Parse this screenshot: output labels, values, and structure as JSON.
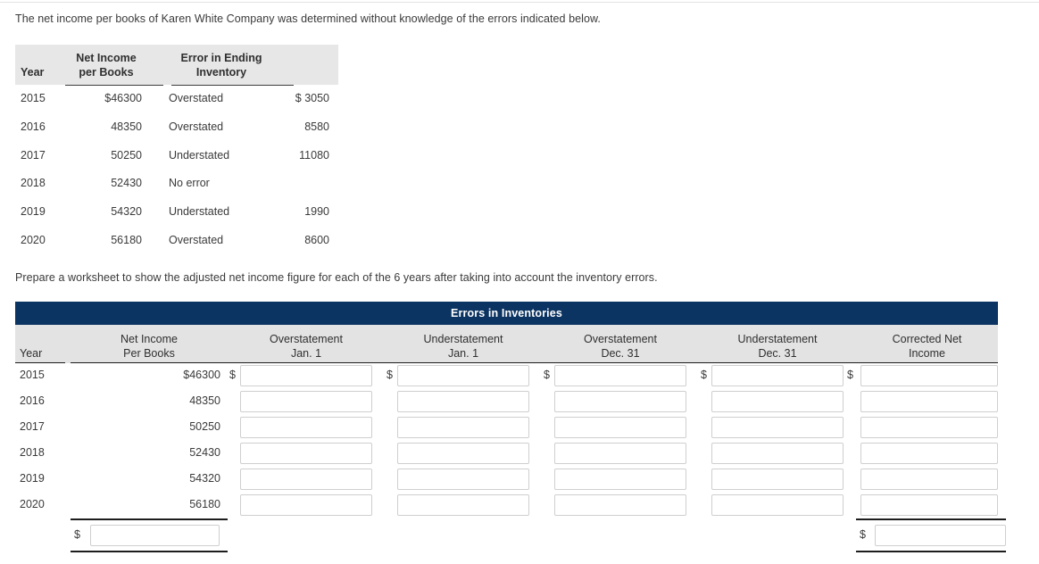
{
  "prompts": {
    "intro": "The net income per books of Karen White Company was determined without knowledge of the errors indicated below.",
    "task": "Prepare a worksheet to show the adjusted net income figure for each of the 6 years after taking into account the inventory errors."
  },
  "given_table": {
    "headers": {
      "year": "Year",
      "net_income_l1": "Net Income",
      "net_income_l2": "per Books",
      "error_l1": "Error in Ending",
      "error_l2": "Inventory",
      "amount": ""
    },
    "rows": [
      {
        "year": "2015",
        "net_income": "$46300",
        "error_type": "Overstated",
        "amount": "$ 3050"
      },
      {
        "year": "2016",
        "net_income": "48350",
        "error_type": "Overstated",
        "amount": "8580"
      },
      {
        "year": "2017",
        "net_income": "50250",
        "error_type": "Understated",
        "amount": "11080"
      },
      {
        "year": "2018",
        "net_income": "52430",
        "error_type": "No error",
        "amount": ""
      },
      {
        "year": "2019",
        "net_income": "54320",
        "error_type": "Understated",
        "amount": "1990"
      },
      {
        "year": "2020",
        "net_income": "56180",
        "error_type": "Overstated",
        "amount": "8600"
      }
    ]
  },
  "worksheet": {
    "banner": "Errors in Inventories",
    "banner_color": "#0c3462",
    "header_bg": "#e3e3e3",
    "columns": {
      "year": {
        "l1": "",
        "l2": "Year"
      },
      "net_income": {
        "l1": "Net Income",
        "l2": "Per Books"
      },
      "over_jan": {
        "l1": "Overstatement",
        "l2": "Jan. 1"
      },
      "under_jan": {
        "l1": "Understatement",
        "l2": "Jan. 1"
      },
      "over_dec": {
        "l1": "Overstatement",
        "l2": "Dec. 31"
      },
      "under_dec": {
        "l1": "Understatement",
        "l2": "Dec. 31"
      },
      "corrected": {
        "l1": "Corrected Net",
        "l2": "Income"
      }
    },
    "dollar_sign": "$",
    "rows": [
      {
        "year": "2015",
        "net_income": "$46300",
        "over_jan": "",
        "under_jan": "",
        "over_dec": "",
        "under_dec": "",
        "corrected": ""
      },
      {
        "year": "2016",
        "net_income": "48350",
        "over_jan": "",
        "under_jan": "",
        "over_dec": "",
        "under_dec": "",
        "corrected": ""
      },
      {
        "year": "2017",
        "net_income": "50250",
        "over_jan": "",
        "under_jan": "",
        "over_dec": "",
        "under_dec": "",
        "corrected": ""
      },
      {
        "year": "2018",
        "net_income": "52430",
        "over_jan": "",
        "under_jan": "",
        "over_dec": "",
        "under_dec": "",
        "corrected": ""
      },
      {
        "year": "2019",
        "net_income": "54320",
        "over_jan": "",
        "under_jan": "",
        "over_dec": "",
        "under_dec": "",
        "corrected": ""
      },
      {
        "year": "2020",
        "net_income": "56180",
        "over_jan": "",
        "under_jan": "",
        "over_dec": "",
        "under_dec": "",
        "corrected": ""
      }
    ],
    "totals": {
      "net_income_total": "",
      "corrected_total": ""
    }
  }
}
